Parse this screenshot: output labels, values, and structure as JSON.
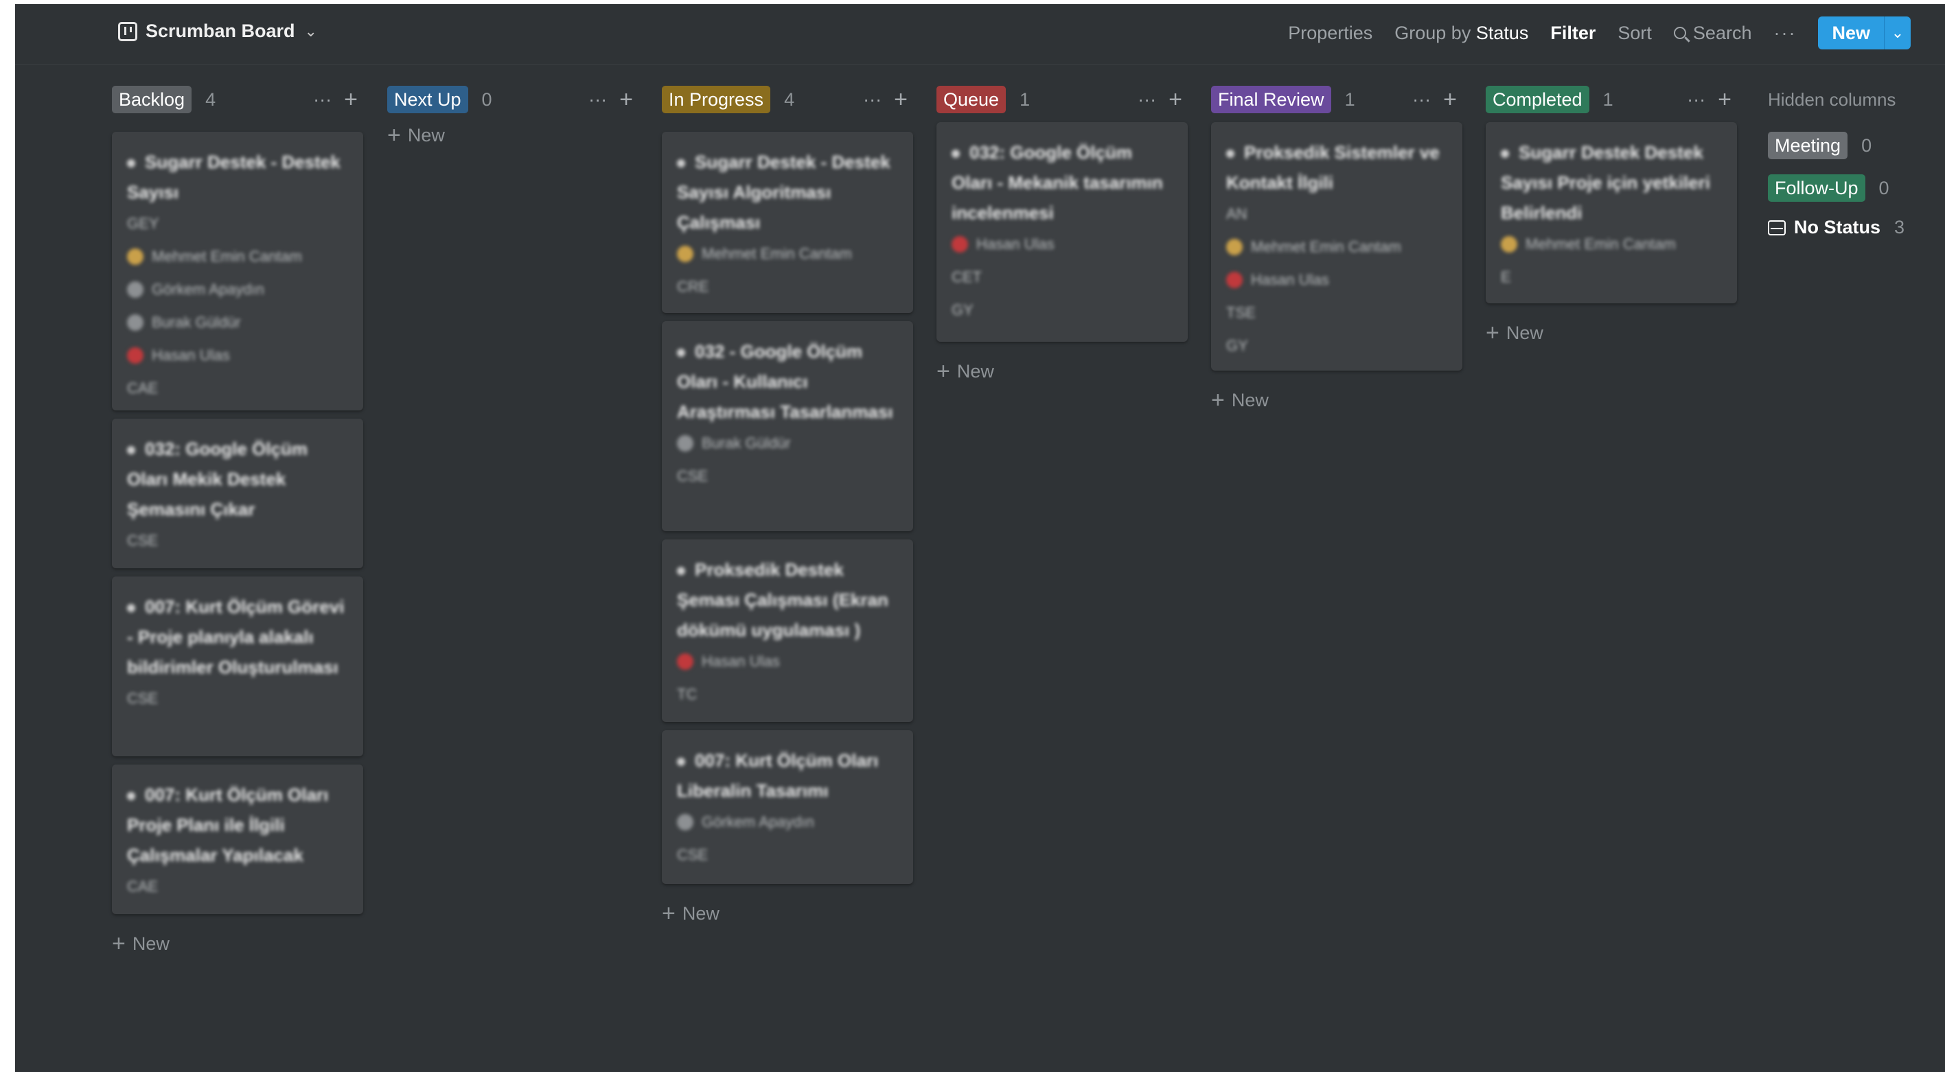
{
  "view": {
    "title": "Scrumban Board"
  },
  "toolbar": {
    "properties": "Properties",
    "group_by_prefix": "Group by ",
    "group_by_value": "Status",
    "filter": "Filter",
    "sort": "Sort",
    "search": "Search",
    "more": "···",
    "new": "New",
    "new_arrow": "⌄"
  },
  "columns": [
    {
      "name": "Backlog",
      "count": "4",
      "color": "#5b5f63",
      "cards": [
        {
          "title": "Sugarr Destek - Destek Sayısı",
          "props": [
            "GEY",
            "Mehmet Emin Cantam",
            "Görkem Apaydın",
            "Burak Güldür",
            "Hasan Ulas",
            "CAE"
          ]
        },
        {
          "title": "032: Google Ölçüm Oları Mekik Destek Şemasını Çıkar",
          "props": [
            "CSE"
          ]
        },
        {
          "title": "007: Kurt Ölçüm Görevi - Proje planıyla alakalı bildirimler Oluşturulması",
          "props": [
            "CSE"
          ]
        },
        {
          "title": "007: Kurt Ölçüm Oları Proje Planı ile İlgili Çalışmalar Yapılacak",
          "props": [
            "CAE"
          ]
        }
      ],
      "add_label": "New"
    },
    {
      "name": "Next Up",
      "count": "0",
      "color": "#2e5f8a",
      "cards": [],
      "add_label": "New"
    },
    {
      "name": "In Progress",
      "count": "4",
      "color": "#8a6d1e",
      "cards": [
        {
          "title": "Sugarr Destek - Destek Sayısı Algoritması Çalışması",
          "props": [
            "Mehmet Emin Cantam",
            "CRE"
          ]
        },
        {
          "title": "032 - Google Ölçüm Oları - Kullanıcı Araştırması Tasarlanması",
          "props": [
            "Burak Güldür",
            "CSE"
          ]
        },
        {
          "title": "Proksedik Destek Şeması Çalışması (Ekran dökümü uygulaması )",
          "props": [
            "Hasan Ulas",
            "TC"
          ]
        },
        {
          "title": "007: Kurt Ölçüm Oları Liberalin Tasarımı",
          "props": [
            "Görkem Apaydın",
            "CSE"
          ]
        }
      ],
      "add_label": "New"
    },
    {
      "name": "Queue",
      "count": "1",
      "color": "#a03b3b",
      "cards": [
        {
          "title": "032: Google Ölçüm Oları - Mekanik tasarımın incelenmesi",
          "props": [
            "Hasan Ulas",
            "CET",
            "GY"
          ]
        }
      ],
      "add_label": "New"
    },
    {
      "name": "Final Review",
      "count": "1",
      "color": "#6a4a9c",
      "cards": [
        {
          "title": "Proksedik Sistemler ve Kontakt İlgili",
          "props": [
            "AN",
            "Mehmet Emin Cantam",
            "Hasan Ulas",
            "TSE",
            "GY"
          ]
        }
      ],
      "add_label": "New"
    },
    {
      "name": "Completed",
      "count": "1",
      "color": "#2f7a5a",
      "cards": [
        {
          "title": "Sugarr Destek Destek Sayısı Proje için yetkileri Belirlendi",
          "props": [
            "Mehmet Emin Cantam",
            "E"
          ]
        }
      ],
      "add_label": "New"
    }
  ],
  "hidden": {
    "title": "Hidden columns",
    "items": [
      {
        "name": "Meeting",
        "count": "0",
        "color": "#6a6e72"
      },
      {
        "name": "Follow-Up",
        "count": "0",
        "color": "#2f7a5a"
      },
      {
        "name": "No Status",
        "count": "3"
      }
    ]
  }
}
